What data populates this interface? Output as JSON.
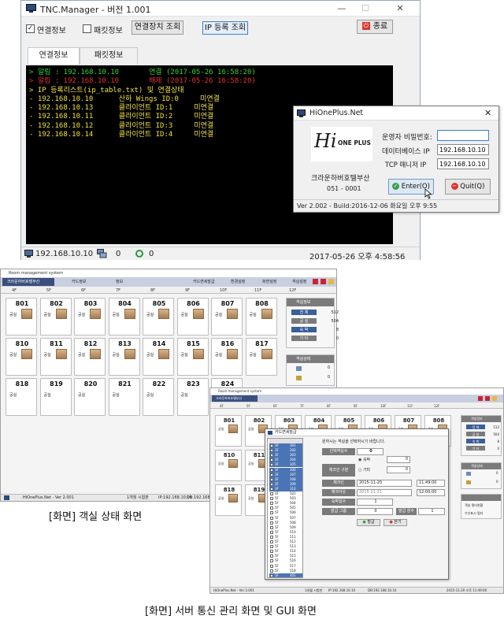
{
  "tnc": {
    "title": "TNC.Manager - 버전 1.001",
    "window_controls": {
      "minimize": "—",
      "maximize": "☐",
      "close": "✕"
    },
    "checkbox_connection": {
      "label": "연결정보",
      "checked": true
    },
    "checkbox_packet": {
      "label": "패킷정보",
      "checked": false
    },
    "btn_device_lookup": "연결장치 조회",
    "btn_ip_register": "IP 등록 조회",
    "btn_exit": "종료",
    "tabs": [
      {
        "label": "연결정보",
        "active": true
      },
      {
        "label": "패킷정보",
        "active": false
      }
    ],
    "console": [
      {
        "text": "> 알림 : 192.168.10.10       연결 (2017-05-26 16:58:20)",
        "color": "#31d431"
      },
      {
        "text": "> 알림 : 192.168.10.10       해제 (2017-05-26 16:58:20)",
        "color": "#e03131"
      },
      {
        "text": "> IP 등록리스트(ip_table.txt) 및 연결상태",
        "color": "#f0e040"
      },
      {
        "text": "- 192.168.10.10      산하 Wings ID:0     미연결",
        "color": "#f0e040"
      },
      {
        "text": "- 192.168.10.13      클라이언트 ID:1     미연결",
        "color": "#f0e040"
      },
      {
        "text": "- 192.168.10.11      클라이언트 ID:2     미연결",
        "color": "#f0e040"
      },
      {
        "text": "- 192.168.10.12      클라이언트 ID:3     미연결",
        "color": "#f0e040"
      },
      {
        "text": "- 192.168.10.14      클라이언트 ID:4     미연결",
        "color": "#f0e040"
      }
    ],
    "status": {
      "ip": "192.168.10.10",
      "count1": "0",
      "count2": "0",
      "datetime": "2017-05-26 오후 4:58:56"
    }
  },
  "dialog": {
    "title": "HiOnePlus.Net",
    "close": "✕",
    "logo_hi": "Hi",
    "logo_rest": "ONE PLUS",
    "hotel_name": "크라운하버호텔부산",
    "hotel_code": "051 - 0001",
    "fields": [
      {
        "label": "운영자 비밀번호:",
        "value": ""
      },
      {
        "label": "데이터베이스 IP",
        "value": "192.168.10.10"
      },
      {
        "label": "TCP 매니저 IP",
        "value": "192.168.10.10"
      }
    ],
    "btn_enter": "Enter(O)",
    "btn_quit": "Quit(Q)",
    "version_line": "Ver 2.002 - Build:2016-12-06 화요일  오후 9:55"
  },
  "room_window": {
    "title": "Room management system",
    "hotel_label": "크라운하버호텔부산",
    "toolbar_left": [
      "카드정보",
      "정보"
    ],
    "toolbar_right": [
      "카드면세발급",
      "환경설정",
      "화면설정",
      "객실설정"
    ],
    "floor_tabs": [
      "4F",
      "5F",
      "6F",
      "7F",
      "8F",
      "9F",
      "10F",
      "11F",
      "12F"
    ],
    "rooms": [
      {
        "no": "801",
        "status": "공실"
      },
      {
        "no": "802",
        "status": "공실"
      },
      {
        "no": "803",
        "status": "공실"
      },
      {
        "no": "804",
        "status": "공실"
      },
      {
        "no": "805",
        "status": "공실"
      },
      {
        "no": "806",
        "status": "공실"
      },
      {
        "no": "807",
        "status": "공실"
      },
      {
        "no": "808",
        "status": "공실"
      },
      {
        "no": "810",
        "status": "공실"
      },
      {
        "no": "811",
        "status": "공실"
      },
      {
        "no": "812",
        "status": "공실"
      },
      {
        "no": "813",
        "status": "공실"
      },
      {
        "no": "814",
        "status": "공실"
      },
      {
        "no": "815",
        "status": "공실"
      },
      {
        "no": "816",
        "status": "공실"
      },
      {
        "no": "817",
        "status": "공실"
      },
      {
        "no": "818",
        "status": "공실"
      },
      {
        "no": "819",
        "status": "공실"
      },
      {
        "no": "820",
        "status": "공실"
      },
      {
        "no": "821",
        "status": "공실"
      },
      {
        "no": "822",
        "status": "공실"
      },
      {
        "no": "823",
        "status": "공실"
      },
      {
        "no": "824",
        "status": "공실"
      }
    ],
    "panel_info_title": "객실정보",
    "panel_info": [
      {
        "k": "전 체",
        "v": "512",
        "color": "#3a5f9a"
      },
      {
        "k": "공 실",
        "v": "504",
        "color": "#7b7b7b"
      },
      {
        "k": "숙 박",
        "v": "8",
        "color": "#3a5f9a"
      },
      {
        "k": "기 타",
        "v": "0",
        "color": "#7b7b7b"
      }
    ],
    "panel_state_title": "객실상태",
    "panel_state": [
      "0",
      "0"
    ],
    "statusbar": {
      "app": "HiOnePlus.Net - Ver 2.001",
      "date": "1개월 시험판",
      "ip": "IP:192.168.10.10",
      "db": "DB:192.168.10.1"
    }
  },
  "caption_left": "[화면] 객실 상태 화면",
  "right_window": {
    "title": "Room management system",
    "hotel_label": "크라운하버호텔부산",
    "floor_tabs": [
      "4F",
      "5F",
      "6F",
      "7F",
      "8F",
      "9F",
      "10F",
      "11F",
      "12F"
    ],
    "rooms": [
      {
        "no": "801",
        "status": "공실"
      },
      {
        "no": "802",
        "status": "공실"
      },
      {
        "no": "803",
        "status": "공실"
      },
      {
        "no": "804",
        "status": "공실"
      },
      {
        "no": "805",
        "status": "공실"
      },
      {
        "no": "806",
        "status": "공실"
      },
      {
        "no": "807",
        "status": "공실"
      },
      {
        "no": "808",
        "status": "공실"
      },
      {
        "no": "810",
        "status": "공실"
      },
      {
        "no": "811",
        "status": "공실"
      },
      {
        "no": "818",
        "status": "공실"
      },
      {
        "no": "819",
        "status": "공실"
      }
    ],
    "panel_info": [
      {
        "k": "전 체",
        "v": "512",
        "color": "#3a5f9a"
      },
      {
        "k": "공 실",
        "v": "504",
        "color": "#7b7b7b"
      },
      {
        "k": "숙 박",
        "v": "8",
        "color": "#3a5f9a"
      },
      {
        "k": "기 타",
        "v": "0",
        "color": "#7b7b7b"
      }
    ],
    "panel_state": [
      "0",
      "0"
    ],
    "panel_extra": [
      "객실 필터현황",
      "수신표시 필터"
    ],
    "statusbar": {
      "app": "HiOnePlus.Net - Ver 2.001",
      "date": "1개월 시험판",
      "ip": "IP:192.168.10.10",
      "db": "DB:192.168.10.10",
      "right": "2015-11-20 오후 11:49:00"
    }
  },
  "popup": {
    "title": "카드면세발급",
    "notice": "원하시는 객실을 선택하시기 바랍니다.",
    "room_list": [
      {
        "floor": "3F",
        "room": "301",
        "sel": true
      },
      {
        "floor": "3F",
        "room": "302",
        "sel": true
      },
      {
        "floor": "3F",
        "room": "303",
        "sel": true
      },
      {
        "floor": "3F",
        "room": "304",
        "sel": true
      },
      {
        "floor": "3F",
        "room": "305",
        "sel": true
      },
      {
        "floor": "3F",
        "room": "306",
        "sel": true
      },
      {
        "floor": "3F",
        "room": "307",
        "sel": true
      },
      {
        "floor": "3F",
        "room": "308",
        "sel": true
      },
      {
        "floor": "3F",
        "room": "309",
        "sel": true
      },
      {
        "floor": "3F",
        "room": "310",
        "sel": true
      },
      {
        "floor": "3F",
        "room": "501",
        "sel": false
      },
      {
        "floor": "5F",
        "room": "503",
        "sel": false
      },
      {
        "floor": "5F",
        "room": "504",
        "sel": false
      },
      {
        "floor": "5F",
        "room": "505",
        "sel": false
      },
      {
        "floor": "5F",
        "room": "506",
        "sel": false
      },
      {
        "floor": "5F",
        "room": "507",
        "sel": false
      },
      {
        "floor": "5F",
        "room": "508",
        "sel": false
      },
      {
        "floor": "5F",
        "room": "509",
        "sel": false
      },
      {
        "floor": "5F",
        "room": "510",
        "sel": false
      },
      {
        "floor": "5F",
        "room": "511",
        "sel": false
      },
      {
        "floor": "5F",
        "room": "512",
        "sel": false
      },
      {
        "floor": "5F",
        "room": "513",
        "sel": false
      },
      {
        "floor": "5F",
        "room": "514",
        "sel": false
      },
      {
        "floor": "5F",
        "room": "515",
        "sel": false
      },
      {
        "floor": "5F",
        "room": "516",
        "sel": false
      },
      {
        "floor": "5F",
        "room": "517",
        "sel": false
      },
      {
        "floor": "5F",
        "room": "518",
        "sel": false
      },
      {
        "floor": "5F",
        "room": "401",
        "sel": true
      }
    ],
    "selected_count_label": "선택객실수",
    "selected_count": "0",
    "checkin_type_label": "체크인 구분",
    "opt_stay": "숙박",
    "opt_stay_val": "0",
    "opt_other": "기타",
    "opt_other_val": "0",
    "checkin_label": "체크인",
    "checkin_date": "2015-11-20",
    "checkin_time": "11:49:00",
    "checkout_label": "체크아웃",
    "checkout_date": "2015-11-21",
    "checkout_time": "12:00:00",
    "nights_label": "숙박일수",
    "nights": "1",
    "group_label": "발급 그룹",
    "group_val": "0",
    "count_label": "발급 장수",
    "count_val": "1",
    "btn_issue": "발급",
    "btn_close": "닫기"
  },
  "caption_bottom": "[화면] 서버 통신 관리 화면 및 GUI 화면"
}
